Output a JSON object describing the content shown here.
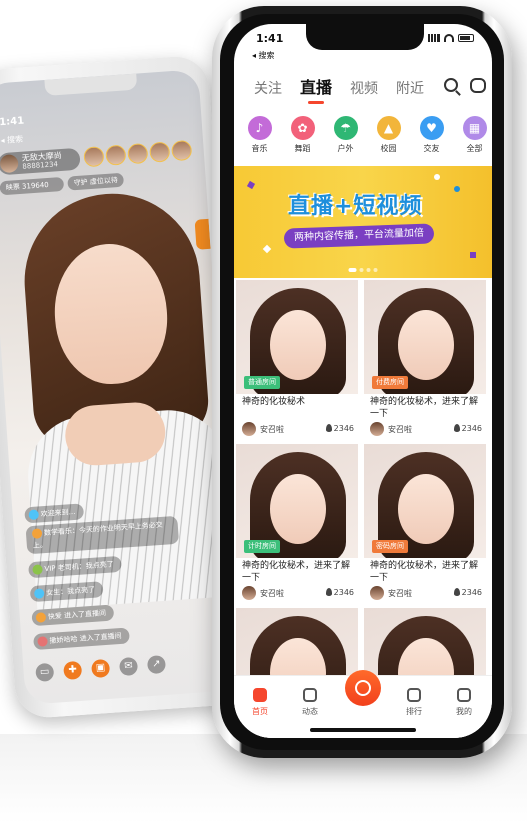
{
  "back_phone": {
    "time": "1:41",
    "nav_back": "◂ 搜索",
    "host": {
      "name": "无敌大摩尚",
      "id": "88881234"
    },
    "stats": "映票 319640",
    "guard": "守护  虚位以待",
    "chat": [
      {
        "text": "欢迎来到...",
        "level_color": "#4fc3f7"
      },
      {
        "text": "数学看乐：今天的作业明天早上务必交上。",
        "level_color": "#f3a23a"
      },
      {
        "text": "VIP  老司机：我点亮了",
        "level_color": "#8bc34a"
      },
      {
        "text": "女生：我点亮了",
        "level_color": "#4fc3f7"
      },
      {
        "text": "快爱  进入了直播间",
        "level_color": "#f3a23a"
      },
      {
        "text": "撒娇哈哈  进入了直播间",
        "level_color": "#e57373"
      }
    ],
    "bottom_icons": [
      "chat-icon",
      "gift-icon",
      "gift-box-icon",
      "mail-icon",
      "share-icon"
    ]
  },
  "front_phone": {
    "status": {
      "time": "1:41",
      "back": "◂ 搜索"
    },
    "tabs": [
      {
        "label": "关注",
        "active": false
      },
      {
        "label": "直播",
        "active": true
      },
      {
        "label": "视频",
        "active": false
      },
      {
        "label": "附近",
        "active": false
      }
    ],
    "categories": [
      {
        "label": "音乐",
        "color": "#c36bd8",
        "glyph": "♪"
      },
      {
        "label": "舞蹈",
        "color": "#f2617a",
        "glyph": "✿"
      },
      {
        "label": "户外",
        "color": "#2fb774",
        "glyph": "☂"
      },
      {
        "label": "校园",
        "color": "#f2b53a",
        "glyph": "▲"
      },
      {
        "label": "交友",
        "color": "#3a9df2",
        "glyph": "♥"
      },
      {
        "label": "全部",
        "color": "#b08ae8",
        "glyph": "▦"
      }
    ],
    "banner": {
      "title": "直播+短视频",
      "subtitle": "两种内容传播，平台流量加倍"
    },
    "cards": [
      {
        "badge": "普通房间",
        "badge_color": "#3cbf7a",
        "title": "神奇的化妆秘术",
        "user": "安召啦",
        "count": "2346"
      },
      {
        "badge": "付费房间",
        "badge_color": "#f07a3a",
        "title": "神奇的化妆秘术，进来了解一下",
        "user": "安召啦",
        "count": "2346"
      },
      {
        "badge": "计时房间",
        "badge_color": "#3cbf7a",
        "title": "神奇的化妆秘术，进来了解一下",
        "user": "安召啦",
        "count": "2346"
      },
      {
        "badge": "密码房间",
        "badge_color": "#f07a3a",
        "title": "神奇的化妆秘术，进来了解一下",
        "user": "安召啦",
        "count": "2346"
      },
      {
        "badge": "",
        "badge_color": "",
        "title": "",
        "user": "",
        "count": ""
      },
      {
        "badge": "",
        "badge_color": "",
        "title": "",
        "user": "",
        "count": ""
      }
    ],
    "tabbar": [
      {
        "label": "首页",
        "active": true
      },
      {
        "label": "动态",
        "active": false
      },
      {
        "label": "",
        "active": false
      },
      {
        "label": "排行",
        "active": false
      },
      {
        "label": "我的",
        "active": false
      }
    ]
  }
}
